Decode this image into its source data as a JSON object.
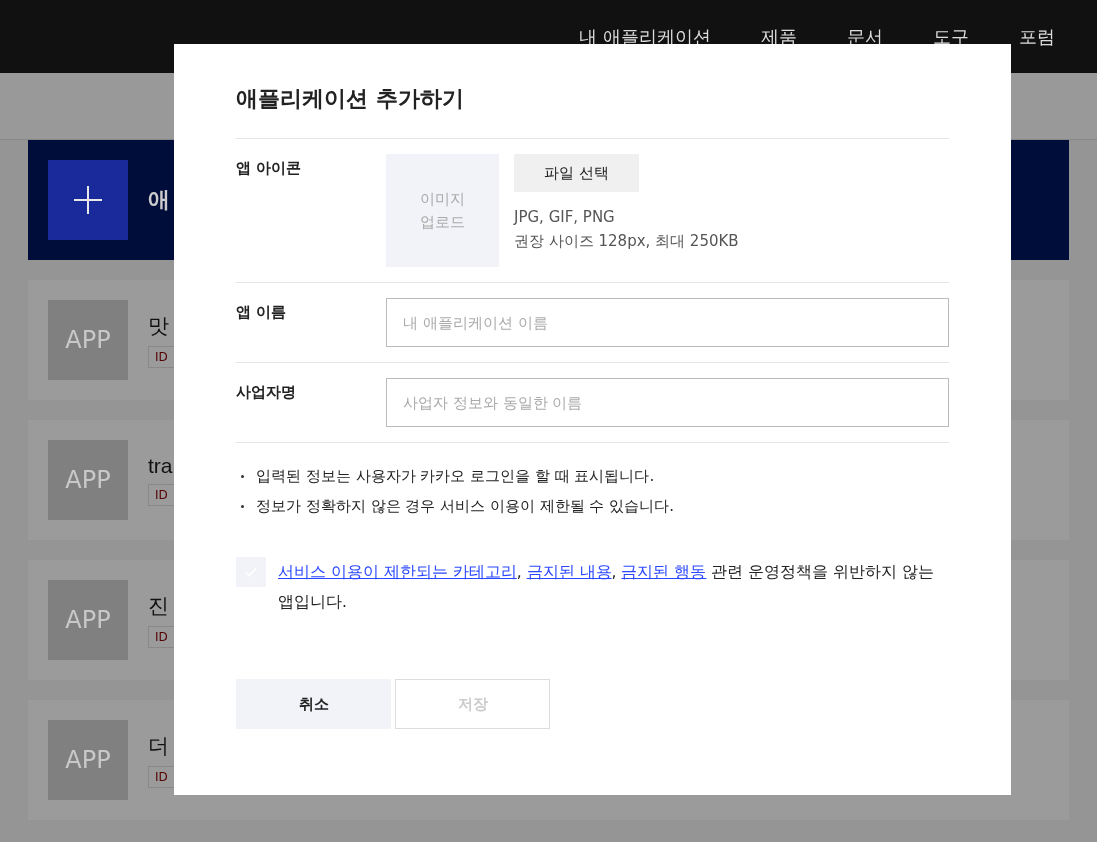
{
  "nav": {
    "items": [
      "내 애플리케이션",
      "제품",
      "문서",
      "도구",
      "포럼"
    ]
  },
  "background": {
    "banner": {
      "title": "애"
    },
    "apps": [
      {
        "icon_text": "APP",
        "name": "맛",
        "tag": "ID"
      },
      {
        "icon_text": "APP",
        "name": "tra",
        "tag": "ID"
      },
      {
        "icon_text": "APP",
        "name": "진",
        "tag": "ID"
      },
      {
        "icon_text": "APP",
        "name": "더",
        "tag": "ID"
      }
    ]
  },
  "dialog": {
    "title": "애플리케이션 추가하기",
    "icon_row": {
      "label": "앱 아이콘",
      "upload_text": "이미지\n업로드",
      "button": "파일 선택",
      "hints": [
        "JPG, GIF, PNG",
        "권장 사이즈 128px, 최대 250KB"
      ]
    },
    "fields": [
      {
        "label": "앱 이름",
        "placeholder": "내 애플리케이션 이름"
      },
      {
        "label": "사업자명",
        "placeholder": "사업자 정보와 동일한 이름"
      }
    ],
    "notes": [
      "입력된 정보는 사용자가 카카오 로그인을 할 때 표시됩니다.",
      "정보가 정확하지 않은 경우 서비스 이용이 제한될 수 있습니다."
    ],
    "consent": {
      "checked": false,
      "parts": [
        {
          "kind": "link",
          "text": "서비스 이용이 제한되는 카테고리"
        },
        {
          "kind": "text",
          "text": ", "
        },
        {
          "kind": "link",
          "text": "금지된 내용"
        },
        {
          "kind": "text",
          "text": ", "
        },
        {
          "kind": "link",
          "text": "금지된 행동"
        },
        {
          "kind": "text",
          "text": " 관련 운영정책을 위반하지 않는 앱입니다."
        }
      ]
    },
    "buttons": [
      {
        "label": "취소",
        "kind": "cancel",
        "disabled": false
      },
      {
        "label": "저장",
        "kind": "save",
        "disabled": true
      }
    ]
  }
}
